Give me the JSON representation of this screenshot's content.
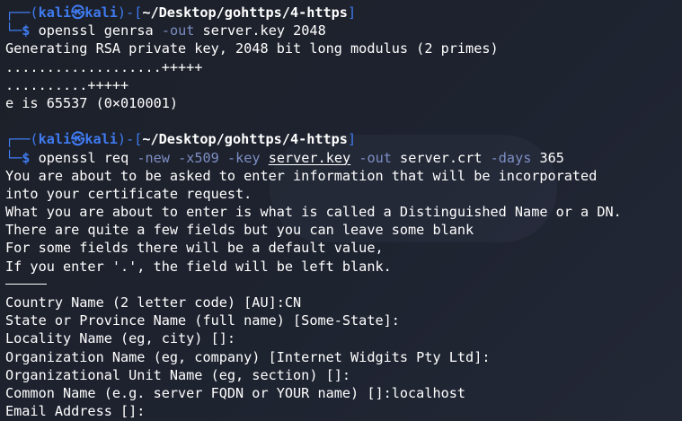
{
  "prompt": {
    "user": "kali",
    "at_glyph": "㉿",
    "host": "kali",
    "path": "~/Desktop/gohttps/4-https",
    "dollar": "$"
  },
  "commands": [
    {
      "program": "openssl",
      "args": [
        {
          "text": "genrsa",
          "kind": "plain"
        },
        {
          "text": "-out",
          "kind": "option"
        },
        {
          "text": "server.key",
          "kind": "plain"
        },
        {
          "text": "2048",
          "kind": "plain"
        }
      ]
    },
    {
      "program": "openssl",
      "args": [
        {
          "text": "req",
          "kind": "plain"
        },
        {
          "text": "-new",
          "kind": "option"
        },
        {
          "text": "-x509",
          "kind": "option"
        },
        {
          "text": "-key",
          "kind": "option"
        },
        {
          "text": "server.key",
          "kind": "path"
        },
        {
          "text": "-out",
          "kind": "option"
        },
        {
          "text": "server.crt",
          "kind": "plain"
        },
        {
          "text": "-days",
          "kind": "option"
        },
        {
          "text": "365",
          "kind": "plain"
        }
      ]
    }
  ],
  "output1": [
    "Generating RSA private key, 2048 bit long modulus (2 primes)",
    "...................+++++",
    "..........+++++",
    "e is 65537 (0×010001)"
  ],
  "output2": [
    "You are about to be asked to enter information that will be incorporated",
    "into your certificate request.",
    "What you are about to enter is what is called a Distinguished Name or a DN.",
    "There are quite a few fields but you can leave some blank",
    "For some fields there will be a default value,",
    "If you enter '.', the field will be left blank."
  ],
  "fields": [
    "Country Name (2 letter code) [AU]:CN",
    "State or Province Name (full name) [Some-State]:",
    "Locality Name (eg, city) []:",
    "Organization Name (eg, company) [Internet Widgits Pty Ltd]:",
    "Organizational Unit Name (eg, section) []:",
    "Common Name (e.g. server FQDN or YOUR name) []:localhost",
    "Email Address []:"
  ],
  "colors": {
    "prompt_blue": "#3f7bf1",
    "option_purple": "#7e8ec4",
    "text": "#ffffff",
    "background": "#1c2029"
  }
}
